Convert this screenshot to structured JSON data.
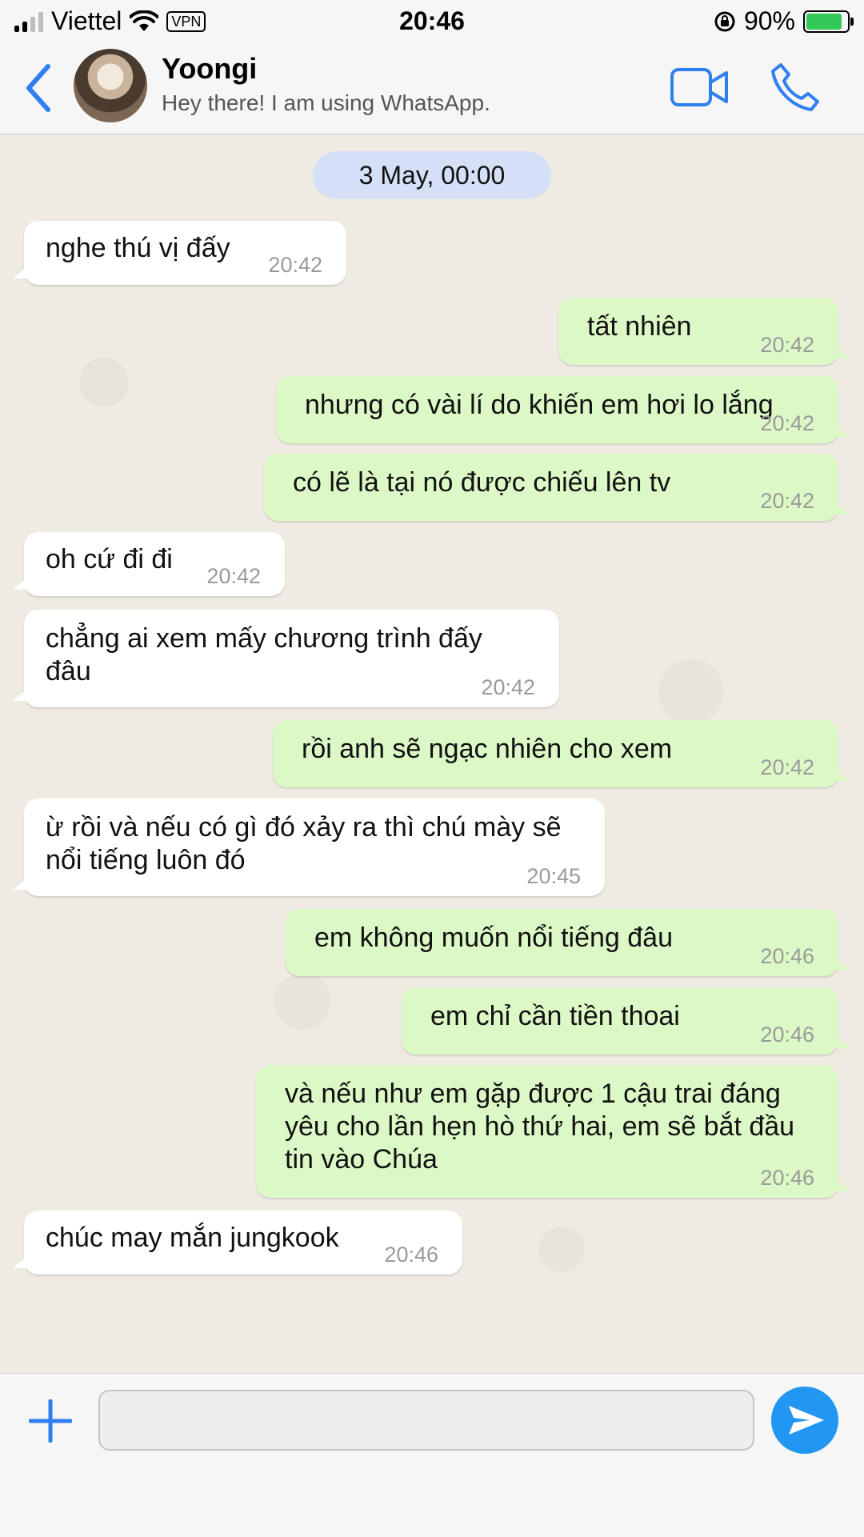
{
  "status_bar": {
    "carrier": "Viettel",
    "vpn": "VPN",
    "time": "20:46",
    "battery": "90%"
  },
  "header": {
    "name": "Yoongi",
    "status": "Hey there! I am using WhatsApp."
  },
  "chat": {
    "date": "3 May, 00:00",
    "messages": [
      {
        "dir": "in",
        "text": "nghe thú vị đấy",
        "time": "20:42"
      },
      {
        "dir": "out",
        "text": "tất nhiên",
        "time": "20:42"
      },
      {
        "dir": "out",
        "text": "nhưng có vài lí do khiến em hơi lo lắng",
        "time": "20:42"
      },
      {
        "dir": "out",
        "text": "có lẽ là tại nó được chiếu lên tv",
        "time": "20:42"
      },
      {
        "dir": "in",
        "text": "oh cứ đi đi",
        "time": "20:42"
      },
      {
        "dir": "in",
        "text": "chẳng ai xem mấy chương trình đấy đâu",
        "time": "20:42"
      },
      {
        "dir": "out",
        "text": "rồi anh sẽ ngạc nhiên cho xem",
        "time": "20:42"
      },
      {
        "dir": "in",
        "text": "ừ rồi và nếu có gì đó xảy ra thì chú mày sẽ nổi tiếng luôn đó",
        "time": "20:45"
      },
      {
        "dir": "out",
        "text": "em không muốn nổi tiếng đâu",
        "time": "20:46"
      },
      {
        "dir": "out",
        "text": "em chỉ cần tiền thoai",
        "time": "20:46"
      },
      {
        "dir": "out",
        "text": "và nếu như em gặp được 1 cậu trai đáng yêu cho lần hẹn hò thứ hai, em sẽ bắt đầu tin vào Chúa",
        "time": "20:46"
      },
      {
        "dir": "in",
        "text": "chúc may mắn jungkook",
        "time": "20:46"
      }
    ]
  },
  "input": {
    "value": "",
    "placeholder": ""
  },
  "colors": {
    "accent": "#2196f3",
    "outgoing_bubble": "#dcf8c6",
    "incoming_bubble": "#ffffff",
    "date_pill": "#d5e0f7"
  }
}
